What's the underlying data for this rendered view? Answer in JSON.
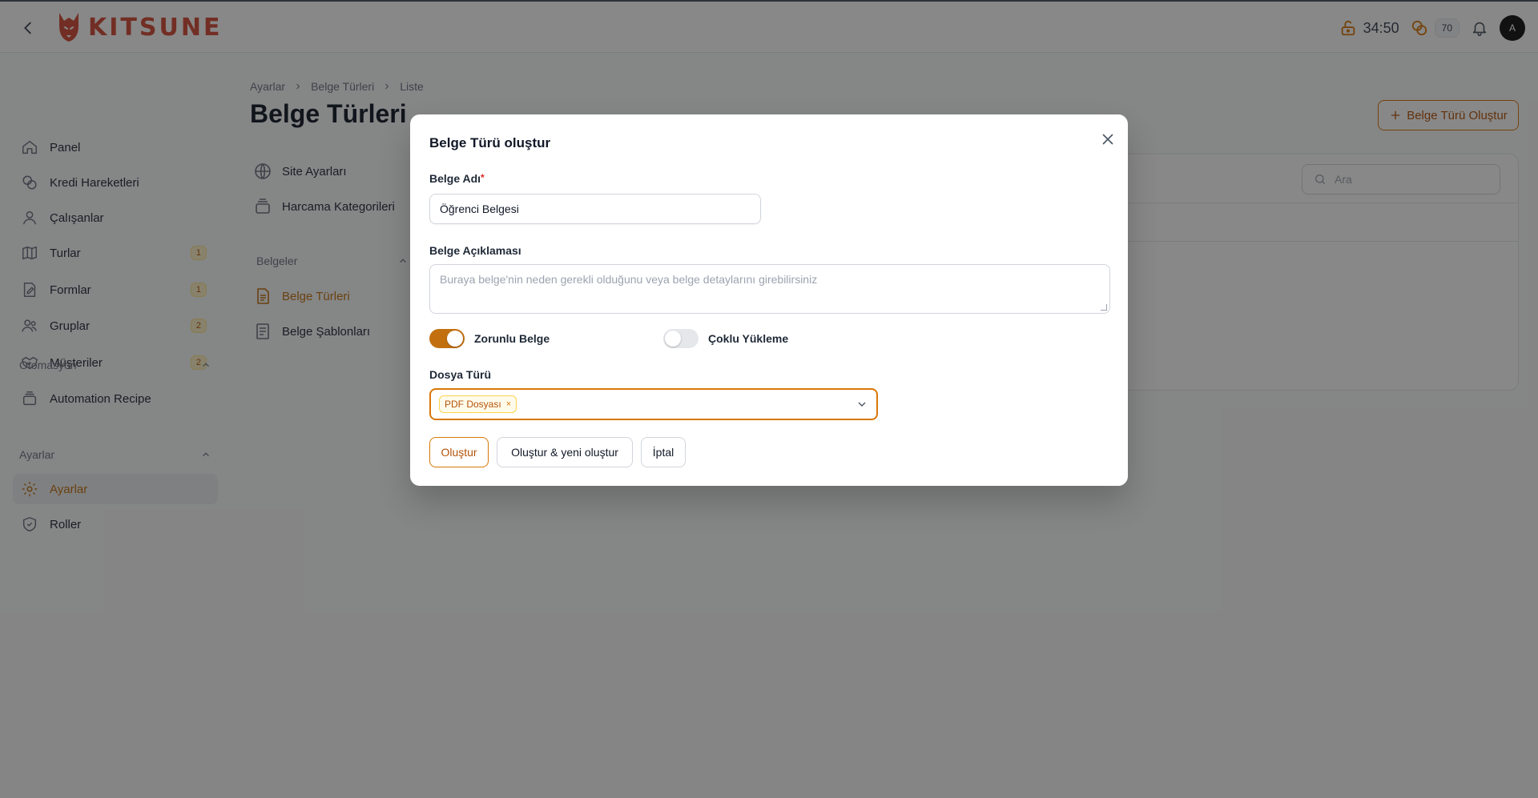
{
  "app": {
    "logo_text": "KITSUNE"
  },
  "header": {
    "timer": "34:50",
    "credit_count": "70",
    "avatar_initial": "A"
  },
  "sidebar": {
    "items": [
      {
        "label": "Panel",
        "badge": ""
      },
      {
        "label": "Kredi Hareketleri",
        "badge": ""
      },
      {
        "label": "Çalışanlar",
        "badge": ""
      },
      {
        "label": "Turlar",
        "badge": "1"
      },
      {
        "label": "Formlar",
        "badge": "1"
      },
      {
        "label": "Gruplar",
        "badge": "2"
      },
      {
        "label": "Müşteriler",
        "badge": "2"
      }
    ],
    "groups": [
      {
        "label": "Otomasyon",
        "items": [
          {
            "label": "Automation Recipe"
          }
        ]
      },
      {
        "label": "Ayarlar",
        "items": [
          {
            "label": "Ayarlar",
            "active": true
          },
          {
            "label": "Roller"
          }
        ]
      }
    ]
  },
  "breadcrumb": [
    "Ayarlar",
    "Belge Türleri",
    "Liste"
  ],
  "page": {
    "title": "Belge Türleri",
    "create_button": "Belge Türü Oluştur",
    "search_placeholder": "Ara"
  },
  "subnav": {
    "items": [
      "Site Ayarları",
      "Harcama Kategorileri"
    ],
    "group_label": "Belgeler",
    "group_items": [
      "Belge Türleri",
      "Belge Şablonları"
    ]
  },
  "modal": {
    "title": "Belge Türü oluştur",
    "name_label": "Belge Adı",
    "required_mark": "*",
    "name_value": "Öğrenci Belgesi",
    "description_label": "Belge Açıklaması",
    "description_placeholder": "Buraya belge'nin neden gerekli olduğunu veya belge detaylarını girebilirsiniz",
    "toggle_required_label": "Zorunlu Belge",
    "toggle_required_on": true,
    "toggle_multi_label": "Çoklu Yükleme",
    "toggle_multi_on": false,
    "file_type_label": "Dosya Türü",
    "file_type_tags": [
      "PDF Dosyası"
    ],
    "tag_remove_glyph": "×",
    "buttons": {
      "create": "Oluştur",
      "create_another": "Oluştur & yeni oluştur",
      "cancel": "İptal"
    }
  },
  "colors": {
    "accent": "#C2700F",
    "logo": "#D24A37",
    "overlay": "rgba(17,17,17,0.5)"
  }
}
